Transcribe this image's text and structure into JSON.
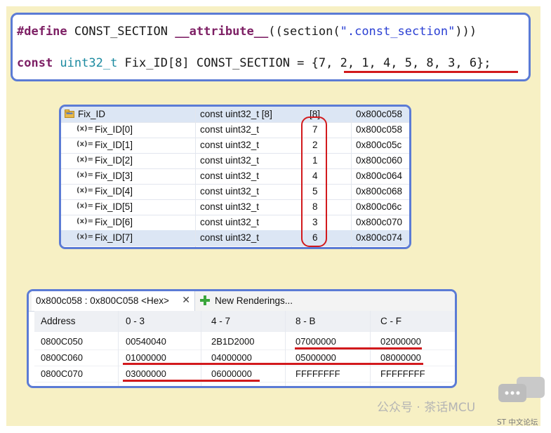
{
  "code": {
    "line1": {
      "directive": "#define",
      "macro": " CONST_SECTION ",
      "attr": "__attribute__",
      "pre": "((section(",
      "section_name": "\".const_section\"",
      "post": ")))"
    },
    "line2": {
      "kw": "const",
      "type": " uint32_t",
      "decl": " Fix_ID[8] CONST_SECTION = ",
      "init": "{7, 2, 1, 4, 5, 8, 3, 6}",
      "end": ";"
    }
  },
  "variables": {
    "root": {
      "name": "Fix_ID",
      "type": "const uint32_t [8]",
      "value": "[8]",
      "address": "0x800c058"
    },
    "icon_label": "(x)=",
    "items": [
      {
        "name": "Fix_ID[0]",
        "type": "const uint32_t",
        "value": "7",
        "address": "0x800c058"
      },
      {
        "name": "Fix_ID[1]",
        "type": "const uint32_t",
        "value": "2",
        "address": "0x800c05c"
      },
      {
        "name": "Fix_ID[2]",
        "type": "const uint32_t",
        "value": "1",
        "address": "0x800c060"
      },
      {
        "name": "Fix_ID[3]",
        "type": "const uint32_t",
        "value": "4",
        "address": "0x800c064"
      },
      {
        "name": "Fix_ID[4]",
        "type": "const uint32_t",
        "value": "5",
        "address": "0x800c068"
      },
      {
        "name": "Fix_ID[5]",
        "type": "const uint32_t",
        "value": "8",
        "address": "0x800c06c"
      },
      {
        "name": "Fix_ID[6]",
        "type": "const uint32_t",
        "value": "3",
        "address": "0x800c070"
      },
      {
        "name": "Fix_ID[7]",
        "type": "const uint32_t",
        "value": "6",
        "address": "0x800c074"
      }
    ]
  },
  "memory": {
    "tab_label": "0x800c058 : 0x800C058 <Hex>",
    "tab_close": "✕",
    "new_tab_label": "New Renderings...",
    "headers": [
      "Address",
      "0 - 3",
      "4 - 7",
      "8 - B",
      "C - F"
    ],
    "rows": [
      [
        "0800C050",
        "00540040",
        "2B1D2000",
        "07000000",
        "02000000"
      ],
      [
        "0800C060",
        "01000000",
        "04000000",
        "05000000",
        "08000000"
      ],
      [
        "0800C070",
        "03000000",
        "06000000",
        "FFFFFFFF",
        "FFFFFFFF"
      ]
    ]
  },
  "watermark": {
    "text": "公众号 · 茶话MCU",
    "sub": "ST 中文论坛"
  },
  "colors": {
    "frame": "#5b7bd5",
    "highlight": "#d2191c",
    "background": "#f7f0c4"
  }
}
